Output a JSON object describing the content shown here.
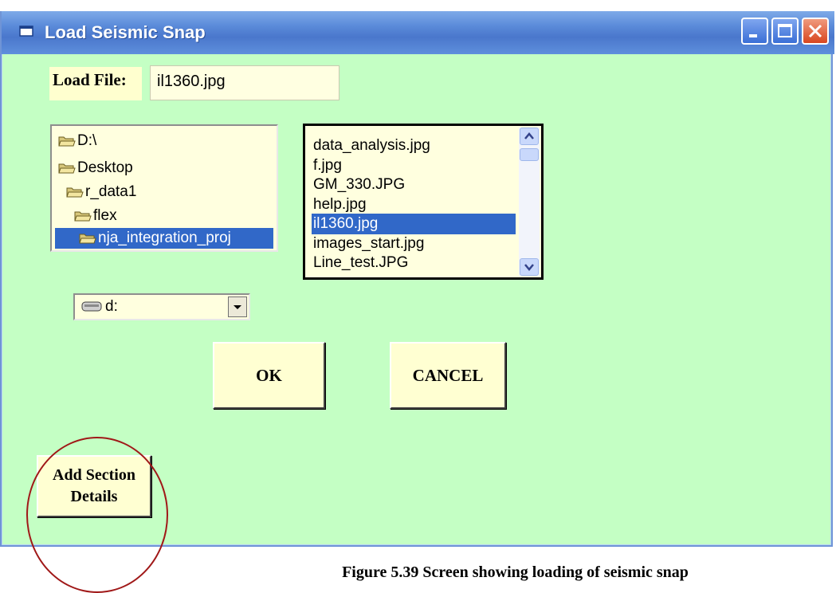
{
  "window": {
    "title": "Load Seismic Snap"
  },
  "load_file": {
    "label": "Load File:",
    "value": "il1360.jpg"
  },
  "directory_list": {
    "items": [
      {
        "label": "D:\\",
        "selected": false
      },
      {
        "label": "Desktop",
        "selected": false
      },
      {
        "label": "r_data1",
        "selected": false
      },
      {
        "label": "flex",
        "selected": false
      },
      {
        "label": "nja_integration_proj",
        "selected": true
      }
    ]
  },
  "file_list": {
    "items": [
      {
        "label": "data_analysis.jpg",
        "selected": false
      },
      {
        "label": "f.jpg",
        "selected": false
      },
      {
        "label": "GM_330.JPG",
        "selected": false
      },
      {
        "label": "help.jpg",
        "selected": false
      },
      {
        "label": "il1360.jpg",
        "selected": true
      },
      {
        "label": "images_start.jpg",
        "selected": false
      },
      {
        "label": "Line_test.JPG",
        "selected": false
      }
    ]
  },
  "drive_combo": {
    "selected": "d:"
  },
  "buttons": {
    "ok": "OK",
    "cancel": "CANCEL",
    "section_line1": "Add Section",
    "section_line2": "Details"
  },
  "caption": "Figure 5.39 Screen showing loading of seismic snap",
  "colors": {
    "form_background": "#c4ffc4",
    "field_background": "#ffffdf",
    "selection": "#3168c8",
    "highlight_circle": "#a01818"
  }
}
